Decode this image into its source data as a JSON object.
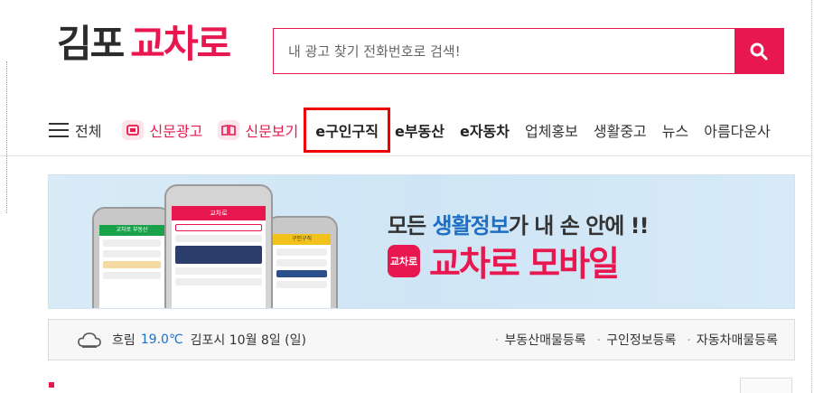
{
  "header": {
    "logo_part1": "김포",
    "logo_part2": "교차로",
    "search_placeholder": "내 광고 찾기 전화번호로 검색!"
  },
  "nav": {
    "menu_label": "전체",
    "items": [
      {
        "label": "신문광고"
      },
      {
        "label": "신문보기"
      },
      {
        "label": "e구인구직"
      },
      {
        "label": "e부동산"
      },
      {
        "label": "e자동차"
      },
      {
        "label": "업체홍보"
      },
      {
        "label": "생활중고"
      },
      {
        "label": "뉴스"
      },
      {
        "label": "아름다운사"
      }
    ]
  },
  "banner": {
    "headline_pre": "모든 ",
    "headline_highlight": "생활정보",
    "headline_post": "가 내 손 안에 !!",
    "app_icon_text": "교차로",
    "app_name": "교차로 모바일",
    "phone_titles": [
      "교차로 부동산",
      "교차로",
      "구인구직"
    ]
  },
  "infobar": {
    "weather": "흐림",
    "temperature": "19.0℃",
    "date": "김포시 10월 8일 (일)",
    "links": [
      "부동산매물등록",
      "구인정보등록",
      "자동차매물등록"
    ]
  },
  "colors": {
    "brand": "#e8174f",
    "accent_blue": "#1c6fc5",
    "highlight_box": "#ee0000"
  }
}
